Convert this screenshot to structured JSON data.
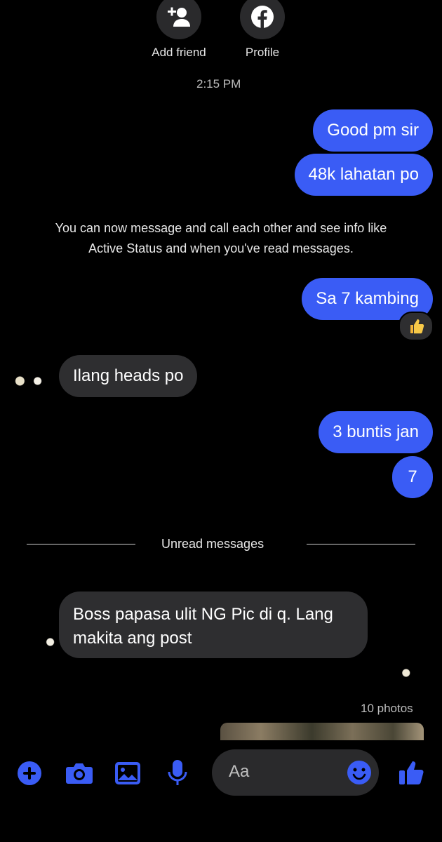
{
  "header": {
    "add_friend_label": "Add friend",
    "profile_label": "Profile"
  },
  "timestamp": "2:15 PM",
  "messages": [
    {
      "dir": "out",
      "text": "Good pm sir"
    },
    {
      "dir": "out",
      "text": "48k lahatan po"
    },
    {
      "dir": "system",
      "line1": "You can now message and call each other and see info like",
      "line2": "Active Status and when you've read messages."
    },
    {
      "dir": "out",
      "text": "Sa 7 kambing",
      "reaction": "thumbs-up"
    },
    {
      "dir": "in",
      "text": "Ilang heads po"
    },
    {
      "dir": "out",
      "text": "3 buntis jan"
    },
    {
      "dir": "out",
      "text": "7"
    },
    {
      "dir": "in",
      "line1": "Boss papasa ulit NG Pic di q. Lang",
      "line2": "makita ang post"
    }
  ],
  "unread_label": "Unread messages",
  "photos_label": "10 photos",
  "composer": {
    "placeholder": "Aa"
  },
  "colors": {
    "accent": "#3a5cf5",
    "incoming_bubble": "#2e2e30",
    "background": "#000000"
  }
}
